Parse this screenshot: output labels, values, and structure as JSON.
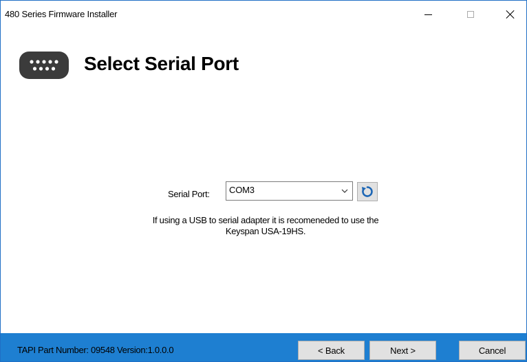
{
  "window": {
    "title": "480 Series Firmware Installer"
  },
  "header": {
    "icon": "serial-port-icon",
    "title": "Select Serial Port"
  },
  "serial": {
    "label": "Serial Port:",
    "selected": "COM3",
    "refresh_icon": "refresh-icon"
  },
  "hint": {
    "line1": "If using a USB to serial adapter it is recomeneded to use the",
    "line2": "Keyspan USA-19HS."
  },
  "footer": {
    "part_info": "TAPI Part Number: 09548  Version:1.0.0.0",
    "back_label": "< Back",
    "next_label": "Next >",
    "cancel_label": "Cancel"
  },
  "colors": {
    "footer_bg": "#1e7fd1",
    "icon_dark": "#3b3b3b",
    "refresh_blue": "#1c66b5"
  }
}
